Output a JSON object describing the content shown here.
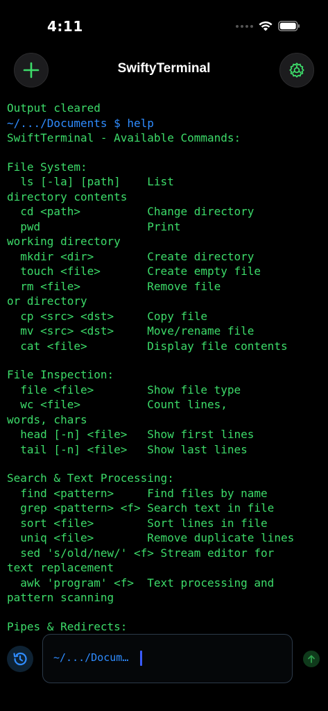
{
  "status_bar": {
    "time": "4:11"
  },
  "nav": {
    "title": "SwiftyTerminal"
  },
  "colors": {
    "output": "#3ddc6a",
    "prompt": "#2f8cff",
    "background": "#000000"
  },
  "terminal": {
    "lines": [
      {
        "text": "Output cleared",
        "kind": "output"
      },
      {
        "text": "~/.../Documents $ help",
        "kind": "prompt"
      },
      {
        "text": "SwiftTerminal - Available Commands:",
        "kind": "output"
      },
      {
        "text": "",
        "kind": "blank"
      },
      {
        "text": "File System:",
        "kind": "output"
      },
      {
        "text": "  ls [-la] [path]    List",
        "kind": "output"
      },
      {
        "text": "directory contents",
        "kind": "output"
      },
      {
        "text": "  cd <path>          Change directory",
        "kind": "output"
      },
      {
        "text": "  pwd                Print",
        "kind": "output"
      },
      {
        "text": "working directory",
        "kind": "output"
      },
      {
        "text": "  mkdir <dir>        Create directory",
        "kind": "output"
      },
      {
        "text": "  touch <file>       Create empty file",
        "kind": "output"
      },
      {
        "text": "  rm <file>          Remove file",
        "kind": "output"
      },
      {
        "text": "or directory",
        "kind": "output"
      },
      {
        "text": "  cp <src> <dst>     Copy file",
        "kind": "output"
      },
      {
        "text": "  mv <src> <dst>     Move/rename file",
        "kind": "output"
      },
      {
        "text": "  cat <file>         Display file contents",
        "kind": "output"
      },
      {
        "text": "",
        "kind": "blank"
      },
      {
        "text": "File Inspection:",
        "kind": "output"
      },
      {
        "text": "  file <file>        Show file type",
        "kind": "output"
      },
      {
        "text": "  wc <file>          Count lines,",
        "kind": "output"
      },
      {
        "text": "words, chars",
        "kind": "output"
      },
      {
        "text": "  head [-n] <file>   Show first lines",
        "kind": "output"
      },
      {
        "text": "  tail [-n] <file>   Show last lines",
        "kind": "output"
      },
      {
        "text": "",
        "kind": "blank"
      },
      {
        "text": "Search & Text Processing:",
        "kind": "output"
      },
      {
        "text": "  find <pattern>     Find files by name",
        "kind": "output"
      },
      {
        "text": "  grep <pattern> <f> Search text in file",
        "kind": "output"
      },
      {
        "text": "  sort <file>        Sort lines in file",
        "kind": "output"
      },
      {
        "text": "  uniq <file>        Remove duplicate lines",
        "kind": "output"
      },
      {
        "text": "  sed 's/old/new/' <f> Stream editor for",
        "kind": "output"
      },
      {
        "text": "text replacement",
        "kind": "output"
      },
      {
        "text": "  awk 'program' <f>  Text processing and",
        "kind": "output"
      },
      {
        "text": "pattern scanning",
        "kind": "output"
      },
      {
        "text": "",
        "kind": "blank"
      },
      {
        "text": "Pipes & Redirects:",
        "kind": "output"
      }
    ]
  },
  "input": {
    "prompt_text": "~/.../Docum…"
  }
}
